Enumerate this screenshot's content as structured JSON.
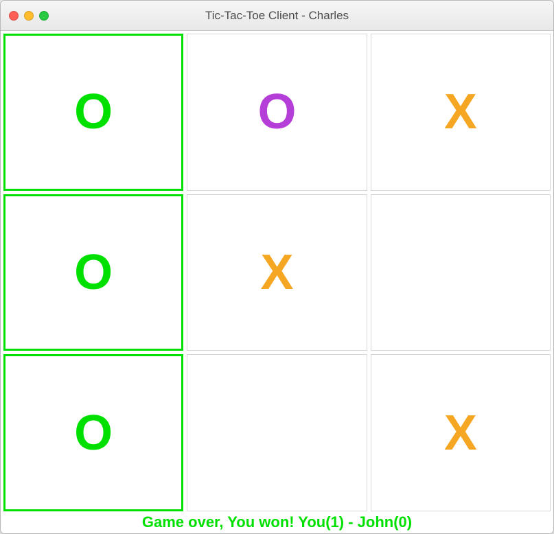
{
  "window": {
    "title": "Tic-Tac-Toe Client - Charles"
  },
  "colors": {
    "win_highlight": "#00e000",
    "o_green": "#00e000",
    "o_purple": "#b63ed8",
    "x_orange": "#f5a623",
    "status_text": "#00e000"
  },
  "board": {
    "cells": [
      {
        "mark": "O",
        "color": "green",
        "winning": true
      },
      {
        "mark": "O",
        "color": "purple",
        "winning": false
      },
      {
        "mark": "X",
        "color": "orange",
        "winning": false
      },
      {
        "mark": "O",
        "color": "green",
        "winning": true
      },
      {
        "mark": "X",
        "color": "orange",
        "winning": false
      },
      {
        "mark": "",
        "color": "",
        "winning": false
      },
      {
        "mark": "O",
        "color": "green",
        "winning": true
      },
      {
        "mark": "",
        "color": "",
        "winning": false
      },
      {
        "mark": "X",
        "color": "orange",
        "winning": false
      }
    ]
  },
  "status": {
    "message": "Game over, You won! You(1) - John(0)"
  }
}
